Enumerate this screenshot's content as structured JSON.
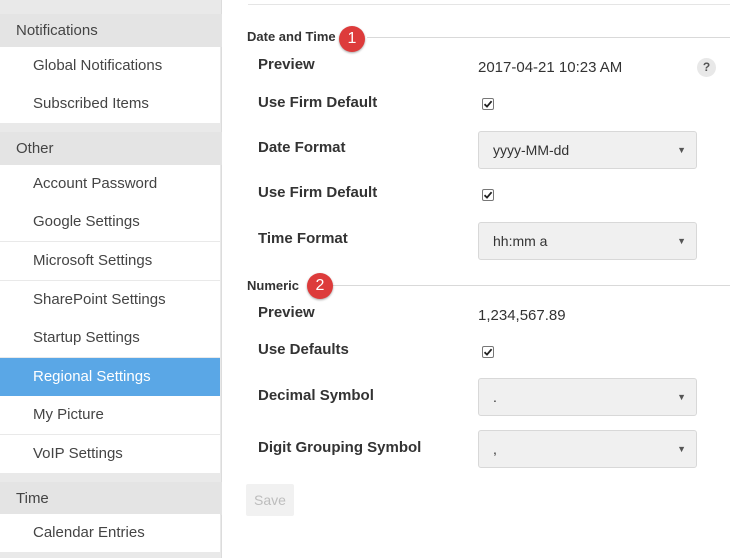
{
  "sidebar": {
    "sections": [
      {
        "title": "Notifications",
        "items": [
          "Global Notifications",
          "Subscribed Items"
        ]
      },
      {
        "title": "Other",
        "items": [
          "Account Password",
          "Google Settings",
          "Microsoft Settings",
          "SharePoint Settings",
          "Startup Settings",
          "Regional Settings",
          "My Picture",
          "VoIP Settings"
        ]
      },
      {
        "title": "Time",
        "items": [
          "Calendar Entries"
        ]
      }
    ],
    "active_item": "Regional Settings",
    "active_color": "#5aa7e6"
  },
  "date_time": {
    "title": "Date and Time",
    "badge": "1",
    "preview_label": "Preview",
    "preview_value": "2017-04-21 10:23 AM",
    "help_icon": "?",
    "use_firm_default_label": "Use Firm Default",
    "date_format_label": "Date Format",
    "date_format_value": "yyyy-MM-dd",
    "use_firm_default_2_label": "Use Firm Default",
    "time_format_label": "Time Format",
    "time_format_value": "hh:mm a"
  },
  "numeric": {
    "title": "Numeric",
    "badge": "2",
    "preview_label": "Preview",
    "preview_value": "1,234,567.89",
    "use_defaults_label": "Use Defaults",
    "decimal_symbol_label": "Decimal Symbol",
    "decimal_symbol_value": ".",
    "digit_grouping_label": "Digit Grouping Symbol",
    "digit_grouping_value": ","
  },
  "actions": {
    "save_label": "Save"
  },
  "colors": {
    "badge": "#dd3b3b",
    "sidebar_bg": "#e9e9e9"
  }
}
